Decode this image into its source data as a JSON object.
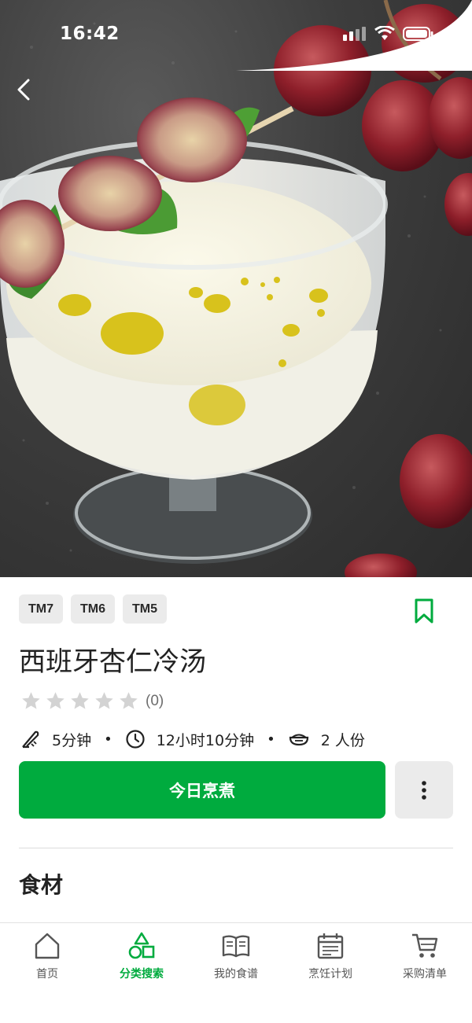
{
  "status_bar": {
    "time": "16:42"
  },
  "recipe": {
    "tags": [
      "TM7",
      "TM6",
      "TM5"
    ],
    "title": "西班牙杏仁冷汤",
    "rating": {
      "stars": 0,
      "max_stars": 5,
      "count_text": "(0)"
    },
    "prep_time": "5分钟",
    "total_time": "12小时10分钟",
    "servings": "2 人份",
    "cook_button_label": "今日烹煮",
    "ingredients_heading": "食材"
  },
  "bottom_nav": {
    "items": [
      {
        "label": "首页",
        "icon": "home-icon",
        "active": false
      },
      {
        "label": "分类搜索",
        "icon": "categories-icon",
        "active": true
      },
      {
        "label": "我的食谱",
        "icon": "book-icon",
        "active": false
      },
      {
        "label": "烹饪计划",
        "icon": "calendar-icon",
        "active": false
      },
      {
        "label": "采购清单",
        "icon": "cart-icon",
        "active": false
      }
    ]
  },
  "colors": {
    "accent": "#00ab3e",
    "tag_bg": "#ebebeb",
    "star_inactive": "#d3d3d3"
  }
}
